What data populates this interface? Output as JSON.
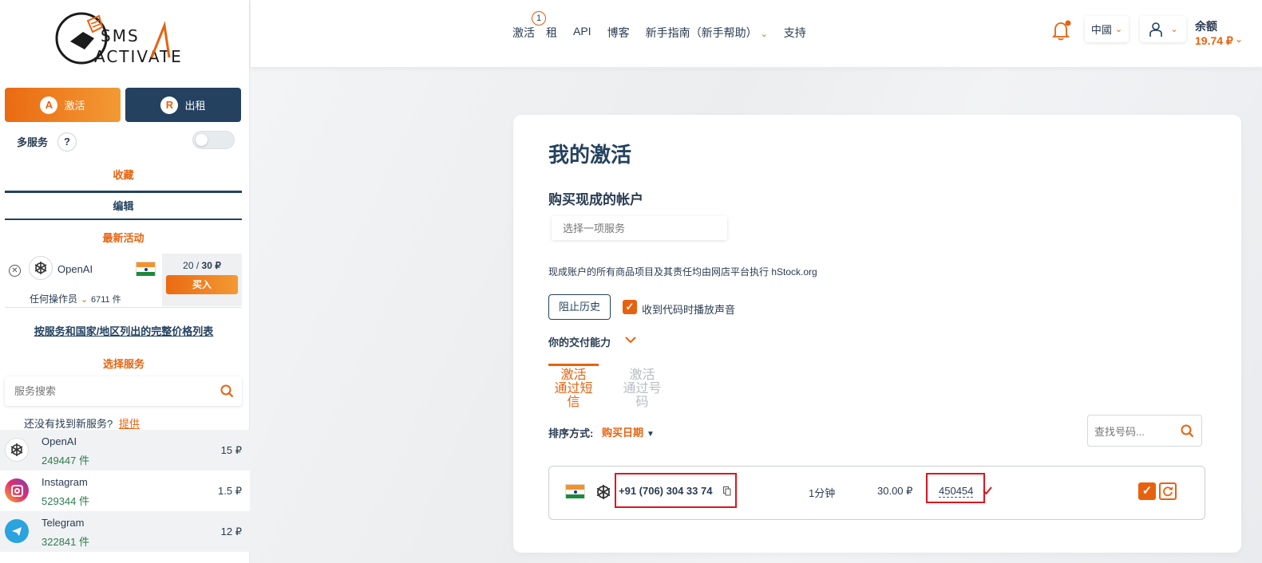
{
  "logo": {
    "line1": "SMS",
    "line2": "ACTIVATE"
  },
  "nav": {
    "items": [
      "激活",
      "租",
      "API",
      "博客",
      "新手指南（新手帮助）",
      "支持"
    ],
    "badge": "1"
  },
  "header": {
    "language": "中國",
    "balance_label": "余额",
    "balance_value": "19.74 ₽"
  },
  "sidebar": {
    "activate_btn": "激活",
    "rent_btn": "出租",
    "multi_service": "多服务",
    "help": "?",
    "favorites": "收藏",
    "edit": "编辑",
    "latest": "最新活动",
    "activity": {
      "service": "OpenAI",
      "count_current": "20",
      "count_sep": " / ",
      "count_total": "30 ₽",
      "buy": "买入",
      "operator": "任何操作员",
      "stock": "6711 件"
    },
    "price_list_link": "按服务和国家/地区列出的完整价格列表",
    "select_service": "选择服务",
    "search_placeholder": "服务搜索",
    "not_found": "还没有找到新服务?",
    "suggest": "提供",
    "services": [
      {
        "name": "OpenAI",
        "count": "249447 件",
        "price": "15 ₽"
      },
      {
        "name": "Instagram",
        "count": "529344 件",
        "price": "1.5 ₽"
      },
      {
        "name": "Telegram",
        "count": "322841 件",
        "price": "12 ₽"
      }
    ]
  },
  "main": {
    "title": "我的激活",
    "ready_accounts": "购买现成的帐户",
    "select_placeholder": "选择一项服务",
    "disclaimer": "现成账户的所有商品项目及其责任均由网店平台执行 hStock.org",
    "block_history": "阻止历史",
    "sound_label": "收到代码时播放声音",
    "delivery": "你的交付能力",
    "tab_sms_line1": "激活",
    "tab_sms_line2": "通过短信",
    "tab_num_line1": "激活",
    "tab_num_line2": "通过号码",
    "sort_label": "排序方式:",
    "sort_value": "购买日期",
    "find_placeholder": "查找号码...",
    "row": {
      "phone": "+91 (706) 304 33 74",
      "time": "1分钟",
      "price": "30.00 ₽",
      "code": "450454"
    }
  },
  "colors": {
    "accent": "#e8620e",
    "navy": "#24425f",
    "red": "#e0141e"
  }
}
